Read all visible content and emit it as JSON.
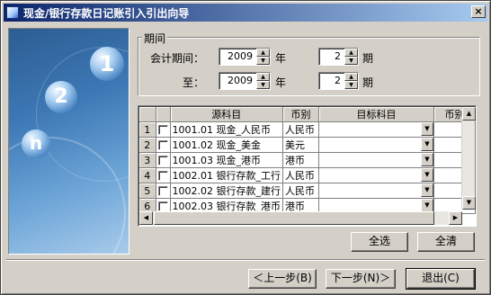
{
  "window": {
    "title": "现金/银行存款日记账引入引出向导",
    "close_glyph": "×"
  },
  "period": {
    "legend": "期间",
    "from_label": "会计期间：",
    "to_label": "至：",
    "year_unit": "年",
    "period_unit": "期",
    "from_year": "2009",
    "from_period": "2",
    "to_year": "2009",
    "to_period": "2"
  },
  "grid": {
    "columns": [
      "源科目",
      "币别",
      "目标科目",
      "币别"
    ],
    "rows": [
      {
        "num": "1",
        "source": "1001.01 现金_人民币",
        "currency": "人民币",
        "target": "",
        "target_currency": ""
      },
      {
        "num": "2",
        "source": "1001.02 现金_美金",
        "currency": "美元",
        "target": "",
        "target_currency": ""
      },
      {
        "num": "3",
        "source": "1001.03 现金_港币",
        "currency": "港币",
        "target": "",
        "target_currency": ""
      },
      {
        "num": "4",
        "source": "1002.01 银行存款_工行",
        "currency": "人民币",
        "target": "",
        "target_currency": ""
      },
      {
        "num": "5",
        "source": "1002.02 银行存款_建行",
        "currency": "人民币",
        "target": "",
        "target_currency": ""
      },
      {
        "num": "6",
        "source": "1002.03 银行存款_港币",
        "currency": "港币",
        "target": "",
        "target_currency": ""
      }
    ]
  },
  "actions": {
    "select_all": "全选",
    "clear_all": "全清",
    "prev": "＜上一步(B)",
    "next": "下一步(N)＞",
    "exit": "退出(C)"
  },
  "decor": {
    "numbers": [
      "1",
      "2",
      "n"
    ]
  }
}
